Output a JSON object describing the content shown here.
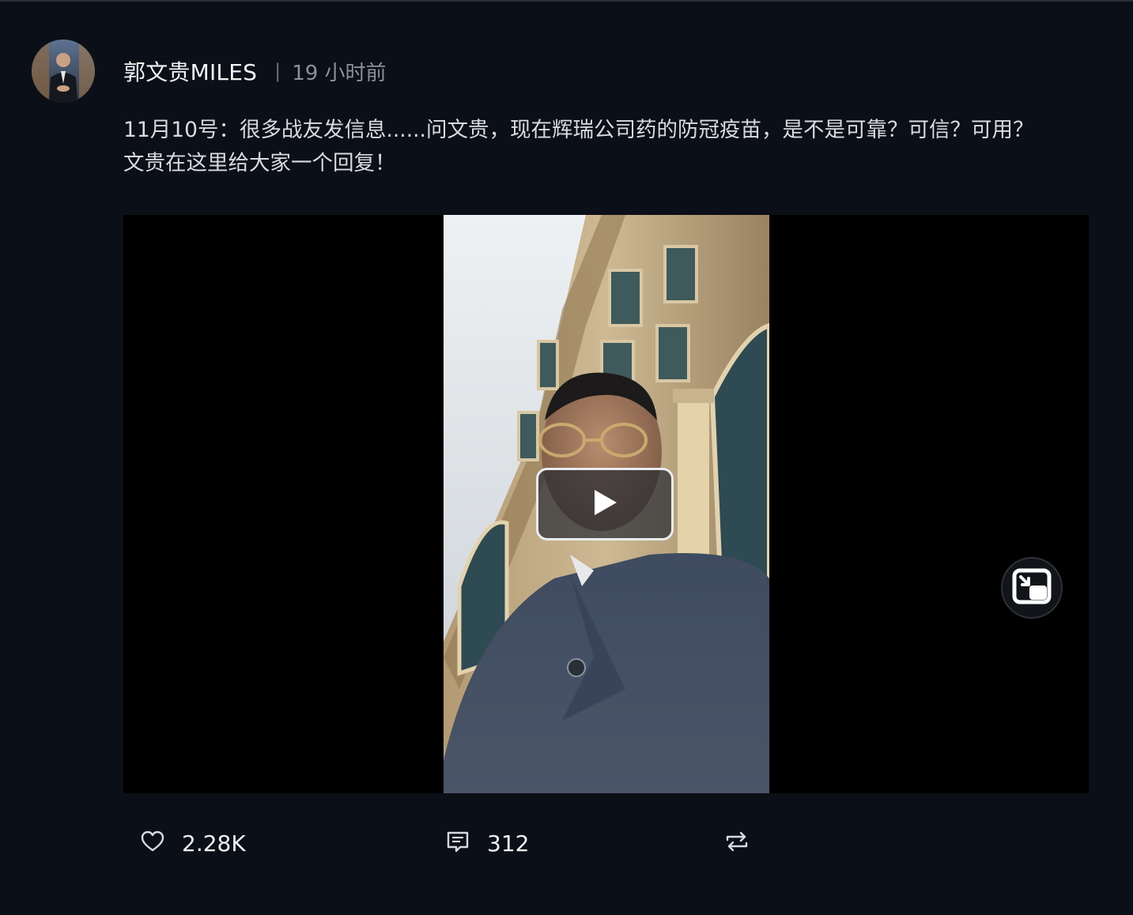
{
  "post": {
    "author_name": "郭文贵MILES",
    "separator": "|",
    "timestamp": "19 小时前",
    "text": "11月10号：很多战友发信息......问文贵，现在辉瑞公司药的防冠疫苗，是不是可靠？可信？可用？\n文贵在这里给大家一个回复！"
  },
  "video": {
    "play_icon": "play-icon",
    "pip_icon": "picture-in-picture-icon"
  },
  "actions": {
    "like_icon": "heart-icon",
    "like_count": "2.28K",
    "comment_icon": "comment-icon",
    "comment_count": "312",
    "repost_icon": "repost-icon"
  },
  "colors": {
    "background": "#0b0f17",
    "text_primary": "#f2f3f5",
    "text_secondary": "#8b909a"
  }
}
